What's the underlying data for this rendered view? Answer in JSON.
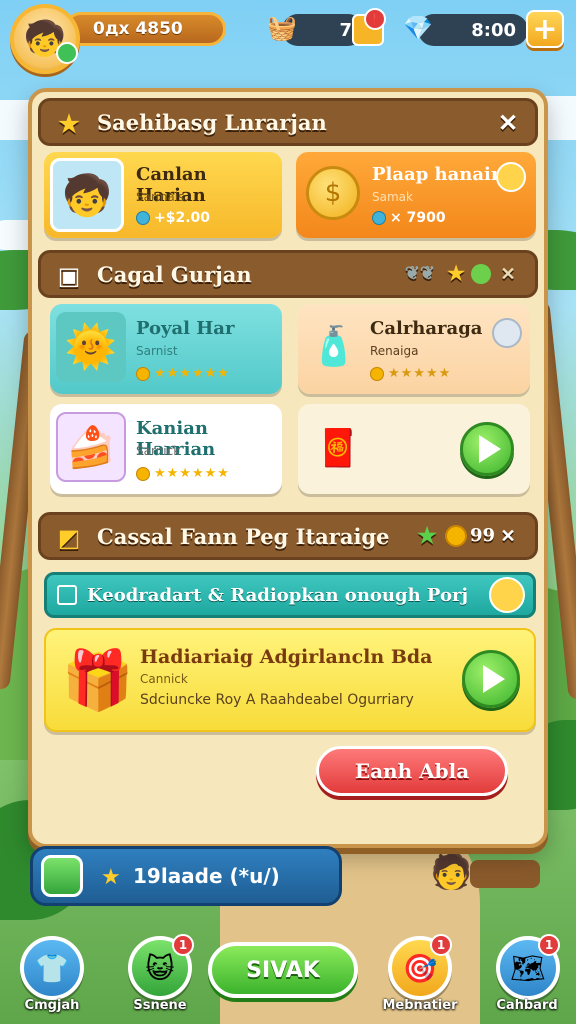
{
  "hud": {
    "coins": "0дх 4850",
    "resource_a": "7",
    "resource_b_badge": "❗",
    "resource_c": "8:00",
    "plus_label": "+"
  },
  "panel": {
    "title": "Saehibasg Lnrarjan",
    "featured": [
      {
        "title": "Canlan Harian",
        "sub": "Sarmais",
        "value": "+$2.00"
      },
      {
        "title": "Plaap hanain",
        "sub": "Samak",
        "value": "× 7900"
      }
    ],
    "section2": {
      "title": "Cagal Gurjan",
      "cards": [
        {
          "title": "Poyal Har",
          "sub": "Sarnist",
          "stars": "★★★★★★"
        },
        {
          "title": "Calrharaga",
          "sub": "Renaiga",
          "stars": "★★★★★"
        },
        {
          "title": "Kanian Harrian",
          "sub": "Sarnick",
          "stars": "★★★★★★"
        }
      ]
    },
    "section3": {
      "title": "Cassal Fann Peg Itaraige",
      "count": "99",
      "banner": "Keodradart & Radiopkan onough Porj",
      "offer": {
        "title": "Hadiariaig Adgirlancln Bda",
        "sub": "Cannick",
        "desc": "Sdciuncke Roy A Raahdeabel Ogurriary"
      },
      "earn_button": "Eanh Abla"
    }
  },
  "bottom_strip": {
    "text": "19laade (*u/)"
  },
  "nav": [
    {
      "label": "Cmgjah",
      "badge": ""
    },
    {
      "label": "Ssnene",
      "badge": "1"
    },
    {
      "label": "SIVAK",
      "badge": ""
    },
    {
      "label": "Mebnatier",
      "badge": "1"
    },
    {
      "label": "Cahbard",
      "badge": "1"
    }
  ],
  "colors": {
    "panel_bg": "#f7e7bd",
    "section_bar": "#8a5b2c",
    "accent_orange": "#f39b1c",
    "accent_green": "#3bb32c",
    "accent_red": "#e23b3b"
  }
}
